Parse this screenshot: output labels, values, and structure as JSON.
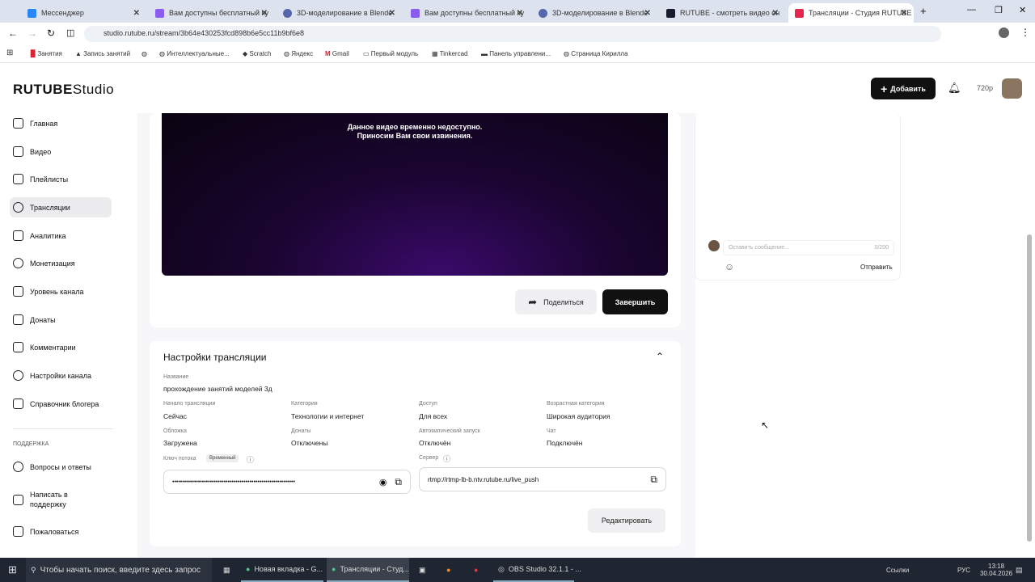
{
  "browser": {
    "tabs": [
      {
        "title": "Мессенджер",
        "color": "#2787f5"
      },
      {
        "title": "Вам доступны бесплатный ку",
        "color": "#8a5cf0"
      },
      {
        "title": "3D-моделирование в Blende",
        "color": "#5566aa"
      },
      {
        "title": "Вам доступны бесплатный ку",
        "color": "#8a5cf0"
      },
      {
        "title": "3D-моделирование в Blende",
        "color": "#5566aa"
      },
      {
        "title": "RUTUBE - смотреть видео он",
        "color": "#1a1a2e"
      },
      {
        "title": "Трансляции - Студия RUTUBE",
        "color": "#e3264c"
      }
    ],
    "url": "studio.rutube.ru/stream/3b64e430253fcd898b6e5cc11b9bf6e8",
    "bookmarks": [
      "Занятия",
      "Запись занятий",
      "Интеллектуальные...",
      "Scratch",
      "Яндекс",
      "Gmail",
      "Первый модуль",
      "Tinkercad",
      "Панель управлени...",
      "Страница Кирилла"
    ]
  },
  "header": {
    "logo": "RUTUBE",
    "logo_suffix": "Studio",
    "add_label": "Добавить",
    "quality": "720p"
  },
  "sidebar": {
    "items": [
      "Главная",
      "Видео",
      "Плейлисты",
      "Трансляции",
      "Аналитика",
      "Монетизация",
      "Уровень канала",
      "Донаты",
      "Комментарии",
      "Настройки канала",
      "Справочник блогера"
    ],
    "support_heading": "ПОДДЕРЖКА",
    "support_items": [
      "Вопросы и ответы",
      "Написать в поддержку",
      "Пожаловаться"
    ]
  },
  "video": {
    "line1": "Данное видео временно недоступно.",
    "line2": "Приносим Вам свои извинения.",
    "share_label": "Поделиться",
    "finish_label": "Завершить"
  },
  "chat": {
    "placeholder": "Оставить сообщение...",
    "counter": "0/200",
    "send_label": "Отправить"
  },
  "settings": {
    "title": "Настройки трансляции",
    "name_label": "Название",
    "name_value": "прохождение занятий моделей 3д",
    "fields": [
      {
        "label": "Начало трансляции",
        "value": "Сейчас"
      },
      {
        "label": "Категория",
        "value": "Технологии и интернет"
      },
      {
        "label": "Доступ",
        "value": "Для всех"
      },
      {
        "label": "Возрастная категория",
        "value": "Широкая аудитория"
      },
      {
        "label": "Обложка",
        "value": "Загружена"
      },
      {
        "label": "Донаты",
        "value": "Отключены"
      },
      {
        "label": "Автоматический запуск",
        "value": "Отключён"
      },
      {
        "label": "Чат",
        "value": "Подключён"
      }
    ],
    "key_label": "Ключ потока",
    "key_badge": "Временный",
    "key_value": "••••••••••••••••••••••••••••••••••••••••••••••••••••••••••••••",
    "server_label": "Сервер",
    "server_value": "rtmp://rtmp-lb-b.ntv.rutube.ru/live_push",
    "edit_label": "Редактировать"
  },
  "taskbar": {
    "search": "Чтобы начать поиск, введите здесь запрос",
    "apps": [
      "Новая вкладка - G...",
      "Трансляции - Студ...",
      "OBS Studio 32.1.1 - ..."
    ],
    "tray": "Ссылки",
    "lang": "РУС",
    "time": "13:18",
    "date": "30.04.2026"
  }
}
